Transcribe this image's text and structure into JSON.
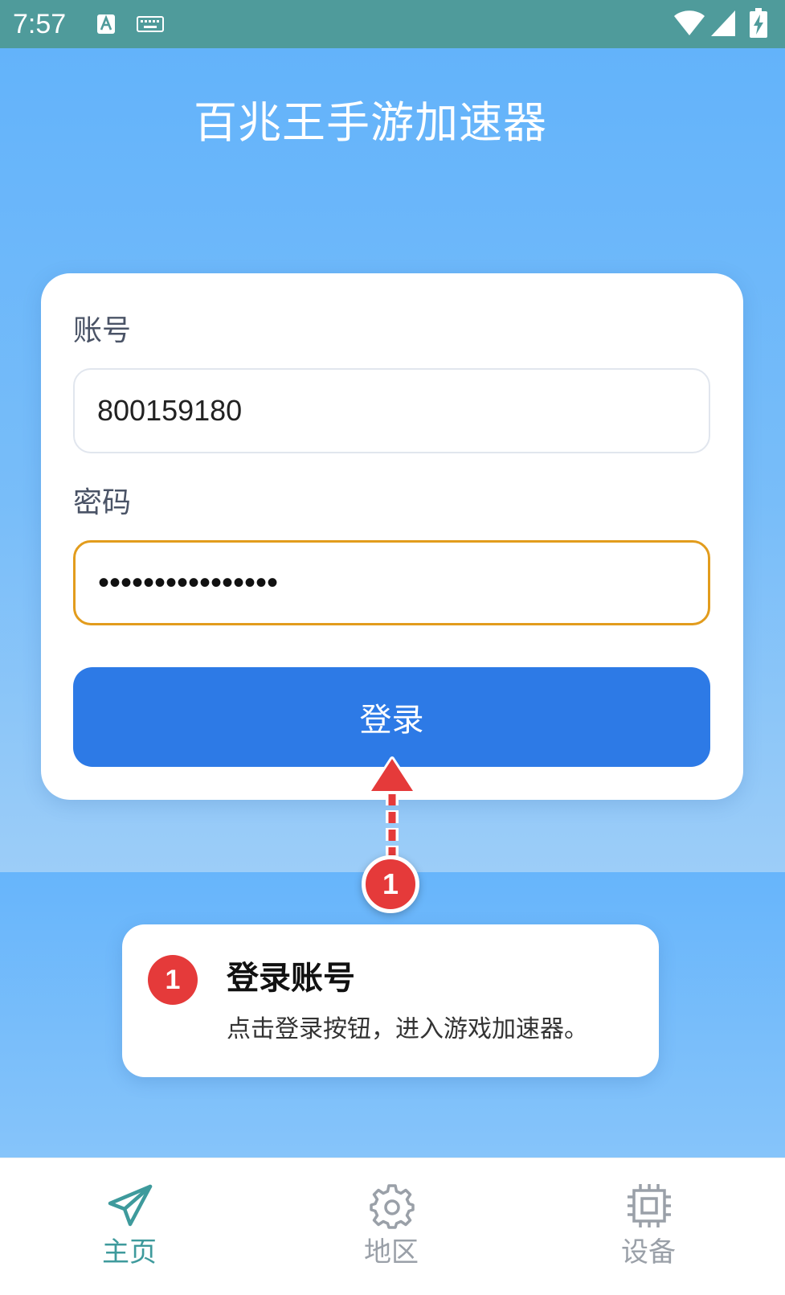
{
  "status_bar": {
    "time": "7:57",
    "icons": [
      "a-input-icon",
      "keyboard-icon",
      "wifi-icon",
      "signal-icon",
      "battery-charging-icon"
    ]
  },
  "app": {
    "title": "百兆王手游加速器"
  },
  "login_form": {
    "account_label": "账号",
    "account_value": "800159180",
    "password_label": "密码",
    "password_value": "••••••••••••••••",
    "login_button_label": "登录"
  },
  "annotation": {
    "step_number": "1",
    "title": "登录账号",
    "description": "点击登录按钮，进入游戏加速器。"
  },
  "bottom_nav": {
    "items": [
      {
        "label": "主页",
        "icon": "paper-plane-icon",
        "active": true
      },
      {
        "label": "地区",
        "icon": "gear-icon",
        "active": false
      },
      {
        "label": "设备",
        "icon": "chip-icon",
        "active": false
      }
    ]
  },
  "colors": {
    "status_bar": "#4f9b9b",
    "background_top": "#63b3fa",
    "primary_button": "#2d7ae6",
    "focus_border": "#e29c1d",
    "annotation_red": "#e53a3a",
    "nav_active": "#3e9a9c",
    "nav_inactive": "#9aa0a8"
  }
}
